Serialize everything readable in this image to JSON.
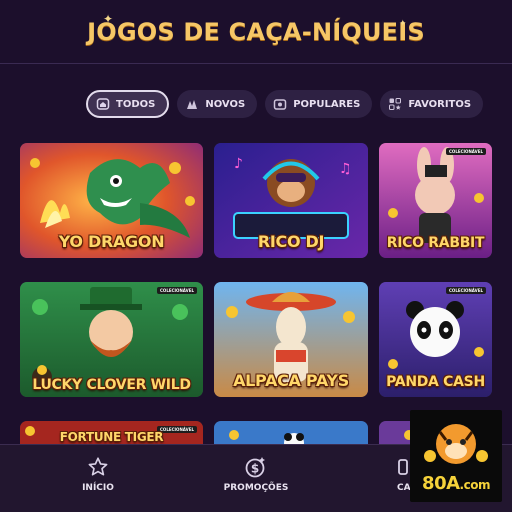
{
  "header": {
    "title": "JOGOS DE CAÇA-NÍQUEIS"
  },
  "filters": [
    {
      "label": "TODOS",
      "icon": "home-icon",
      "active": true
    },
    {
      "label": "NOVOS",
      "icon": "new-sparkle-icon",
      "active": false
    },
    {
      "label": "POPULARES",
      "icon": "camera-icon",
      "active": false
    },
    {
      "label": "FAVORITOS",
      "icon": "favorites-icon",
      "active": false
    }
  ],
  "games": [
    {
      "title": "YO DRAGON",
      "badge": ""
    },
    {
      "title": "RICO DJ",
      "badge": ""
    },
    {
      "title": "RICO RABBIT",
      "badge": "COLECIONÁVEL"
    },
    {
      "title": "LUCKY CLOVER WILD",
      "badge": "COLECIONÁVEL"
    },
    {
      "title": "ALPACA PAYS",
      "badge": ""
    },
    {
      "title": "PANDA CASH",
      "badge": "COLECIONÁVEL"
    },
    {
      "title": "FORTUNE TIGER",
      "badge": "COLECIONÁVEL"
    }
  ],
  "bottom_nav": [
    {
      "label": "INÍCIO",
      "icon": "star-icon"
    },
    {
      "label": "PROMOÇÕES",
      "icon": "dollar-coin-icon"
    },
    {
      "label": "CA",
      "icon": "cashier-icon"
    }
  ],
  "brand": {
    "text": "80A",
    "suffix": ".com"
  },
  "colors": {
    "background": "#1c0f2c",
    "title": "#f6c766",
    "chip": "#2e2143",
    "nav": "#22162f"
  }
}
